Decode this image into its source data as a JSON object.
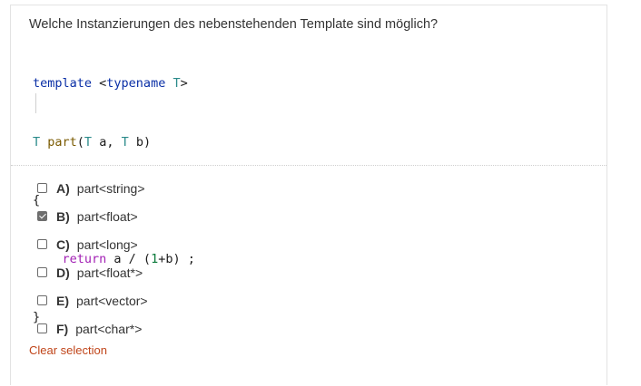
{
  "question": "Welche Instanzierungen des nebenstehenden Template sind möglich?",
  "code": {
    "line1_kw": "template",
    "line1_rest": " <",
    "line1_typename": "typename",
    "line1_T": " T",
    "line1_end": ">",
    "line2_T": "T",
    "line2_fn": " part",
    "line2_open": "(",
    "line2_T2": "T",
    "line2_a": " a, ",
    "line2_T3": "T",
    "line2_b": " b)",
    "line3": "{",
    "line4_indent": "    ",
    "line4_return": "return",
    "line4_mid": " a / (",
    "line4_num": "1",
    "line4_end": "+b) ;",
    "line5": "}"
  },
  "options": [
    {
      "letter": "A)",
      "label": "part<string>",
      "checked": false
    },
    {
      "letter": "B)",
      "label": "part<float>",
      "checked": true
    },
    {
      "letter": "C)",
      "label": "part<long>",
      "checked": false
    },
    {
      "letter": "D)",
      "label": "part<float*>",
      "checked": false
    },
    {
      "letter": "E)",
      "label": "part<vector>",
      "checked": false
    },
    {
      "letter": "F)",
      "label": "part<char*>",
      "checked": false
    }
  ],
  "clear_selection": "Clear selection"
}
